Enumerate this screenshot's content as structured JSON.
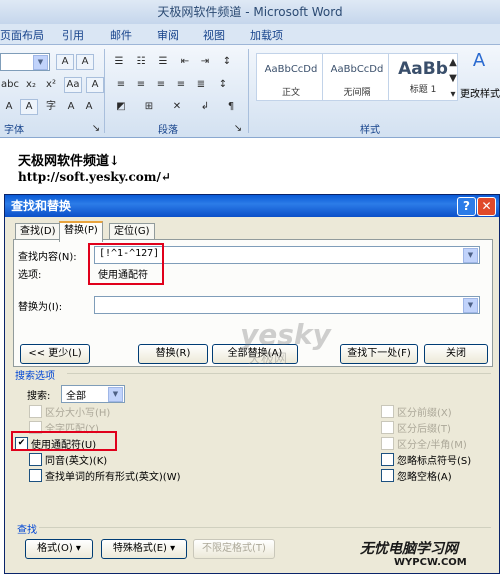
{
  "window": {
    "title": "天极网软件频道 - Microsoft Word"
  },
  "ribbon_tabs": [
    "页面布局",
    "引用",
    "邮件",
    "审阅",
    "视图",
    "加载项"
  ],
  "ribbon": {
    "groups": [
      "字体",
      "段落",
      "样式"
    ],
    "styles": [
      {
        "sample": "AaBbCcDd",
        "label": "正文"
      },
      {
        "sample": "AaBbCcDd",
        "label": "无间隔"
      },
      {
        "sample": "AaBb",
        "label": "标题 1"
      }
    ],
    "change_styles_label": "更改样式"
  },
  "document": {
    "line1": "天极网软件频道↓",
    "line2": "http://soft.yesky.com/↵"
  },
  "dialog": {
    "title": "查找和替换",
    "help": "?",
    "close": "✕",
    "tabs": [
      "查找(D)",
      "替换(P)",
      "定位(G)"
    ],
    "find_label": "查找内容(N):",
    "find_value": "[!^1-^127]",
    "options_label": "选项:",
    "options_value": "使用通配符",
    "replace_label": "替换为(I):",
    "replace_value": "",
    "buttons": {
      "less": "<< 更少(L)",
      "replace": "替换(R)",
      "replace_all": "全部替换(A)",
      "find_next": "查找下一处(F)",
      "close": "关闭"
    },
    "search_options_title": "搜索选项",
    "search_label": "搜索:",
    "search_value": "全部",
    "left_options": [
      {
        "label": "区分大小写(H)",
        "checked": false,
        "disabled": true
      },
      {
        "label": "全字匹配(Y)",
        "checked": false,
        "disabled": true
      },
      {
        "label": "使用通配符(U)",
        "checked": true,
        "disabled": false
      },
      {
        "label": "同音(英文)(K)",
        "checked": false,
        "disabled": false
      },
      {
        "label": "查找单词的所有形式(英文)(W)",
        "checked": false,
        "disabled": false
      }
    ],
    "right_options": [
      {
        "label": "区分前缀(X)",
        "checked": false,
        "disabled": true
      },
      {
        "label": "区分后缀(T)",
        "checked": false,
        "disabled": true
      },
      {
        "label": "区分全/半角(M)",
        "checked": false,
        "disabled": true
      },
      {
        "label": "忽略标点符号(S)",
        "checked": false,
        "disabled": false
      },
      {
        "label": "忽略空格(A)",
        "checked": false,
        "disabled": false
      }
    ],
    "find_section_title": "查找",
    "bottom_buttons": [
      "格式(O) ▾",
      "特殊格式(E) ▾",
      "不限定格式(T)"
    ]
  },
  "watermark": {
    "text": "yesky",
    "subtext": "天极网"
  },
  "corner_watermark": {
    "text": "无忧电脑学习网",
    "subtext": "WYPCW.COM"
  },
  "colors": {
    "highlight": "#e0001b",
    "dialog_title": "#0a5ad6"
  }
}
